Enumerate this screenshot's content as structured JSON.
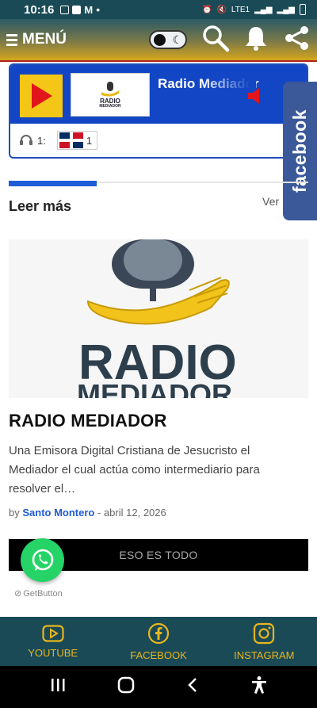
{
  "status_bar": {
    "time": "10:16",
    "dot": "•",
    "network": "LTE1"
  },
  "header": {
    "menu_label": "MENÚ"
  },
  "player": {
    "station_name": "Radio Mediador",
    "logo_line1": "RADIO",
    "logo_line2": "MEDIADOR",
    "listeners_label": "1:",
    "country_count": "1"
  },
  "facebook_tab": {
    "label": "facebook"
  },
  "section": {
    "title": "Leer más",
    "more_label": "Ver"
  },
  "article": {
    "image_text_1": "RADIO",
    "image_text_2": "MEDIADOR",
    "title": "RADIO MEDIADOR",
    "excerpt": "Una  Emisora Digital Cristiana de Jesucristo el Mediador  el cual actúa como intermediario para resolver el…",
    "meta_by": "by",
    "author": "Santo Montero",
    "meta_sep": "-",
    "date": "abril 12, 2026"
  },
  "end_bar": {
    "label": "ESO ES TODO"
  },
  "getbutton": {
    "label": "GetButton"
  },
  "bottom_nav": {
    "items": [
      {
        "label": "YOUTUBE",
        "icon": "youtube-icon"
      },
      {
        "label": "FACEBOOK",
        "icon": "facebook-icon"
      },
      {
        "label": "INSTAGRAM",
        "icon": "instagram-icon"
      }
    ]
  },
  "colors": {
    "status_bg": "#1b4a57",
    "player_blue": "#1346c4",
    "accent_yellow": "#f4c617",
    "facebook_blue": "#3b5998",
    "whatsapp_green": "#25d366",
    "nav_gold": "#e8b61c"
  }
}
